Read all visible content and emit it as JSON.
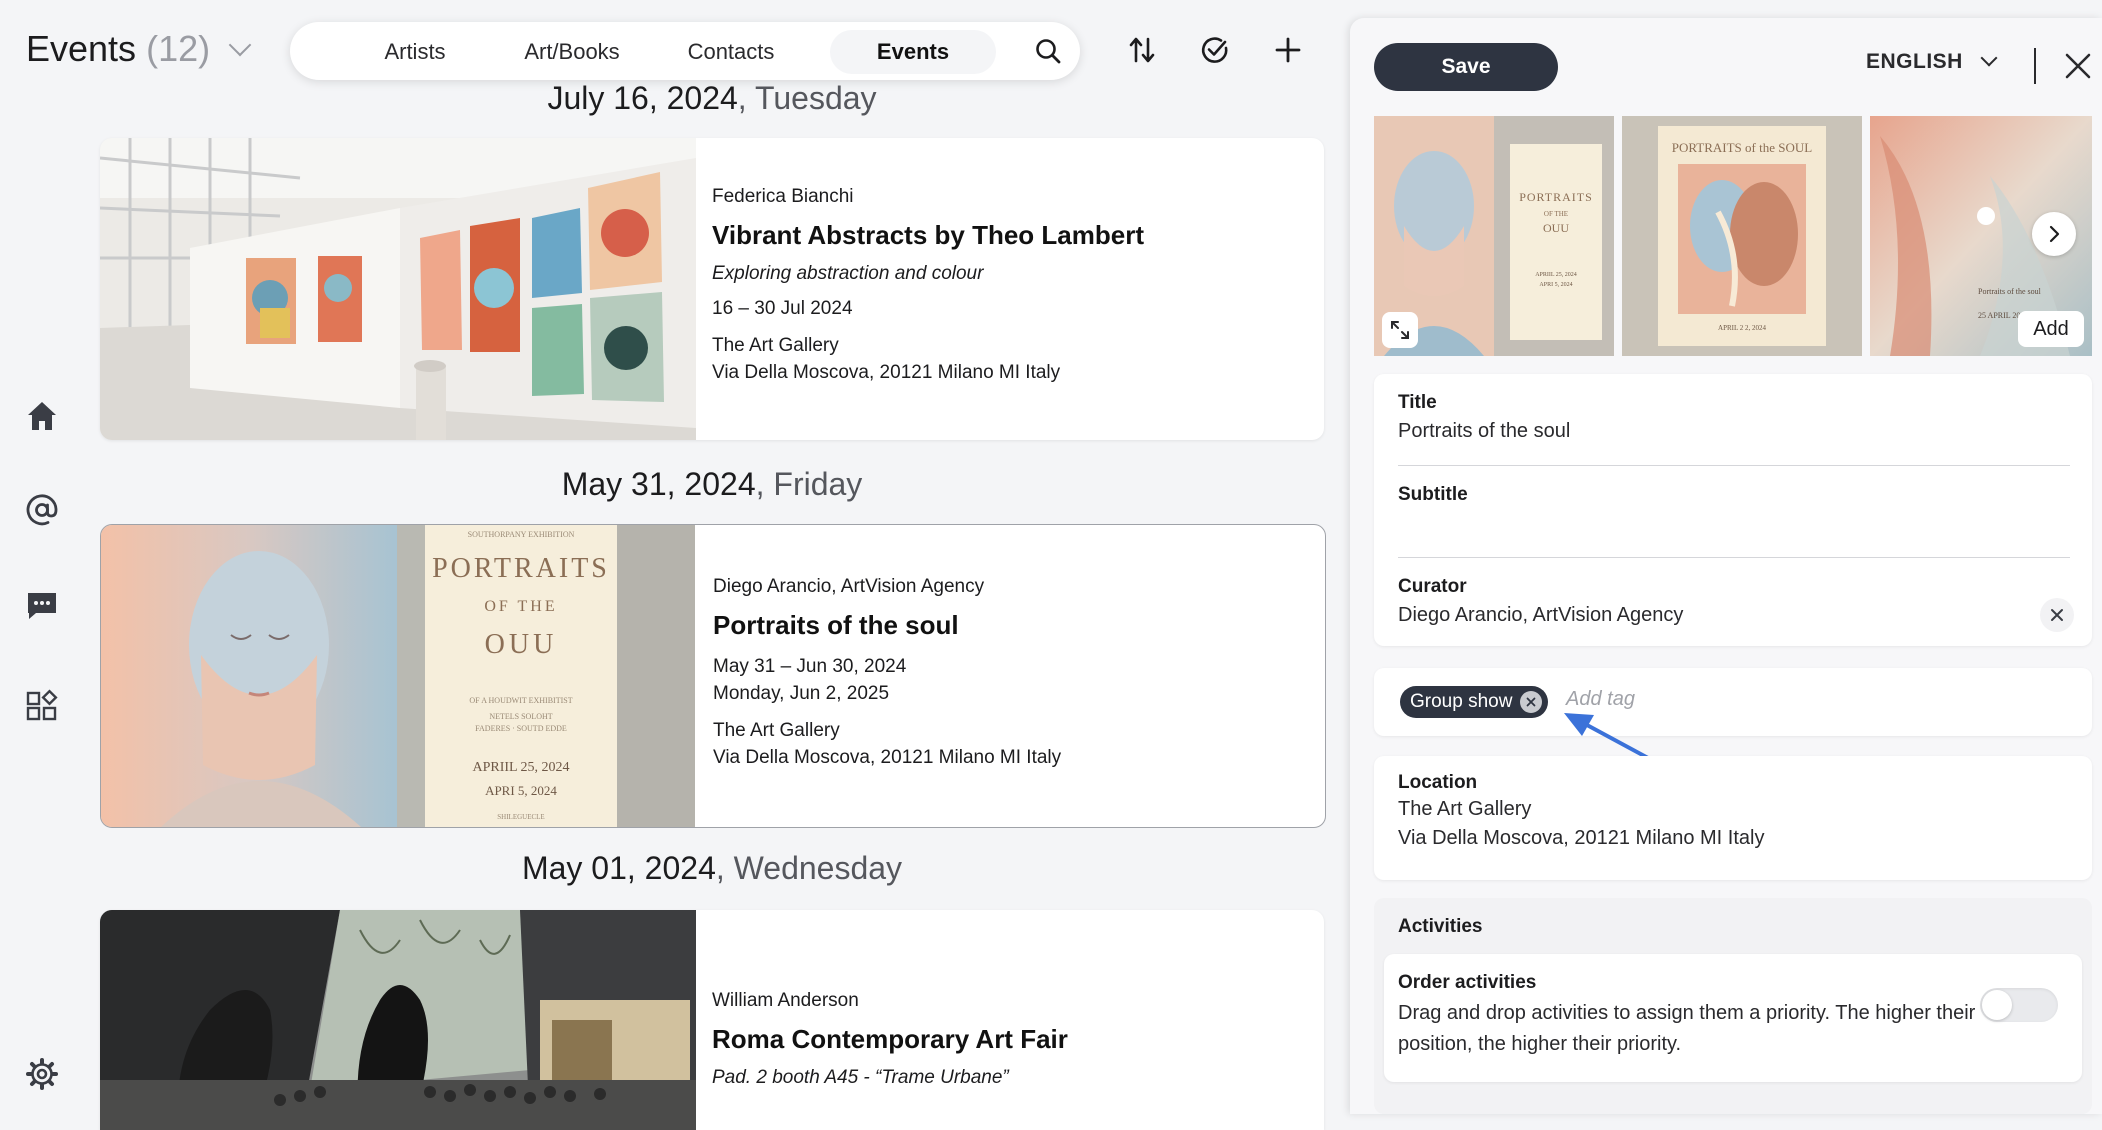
{
  "header": {
    "title": "Events",
    "count": "(12)",
    "tabs": [
      {
        "label": "Artists",
        "active": false
      },
      {
        "label": "Art/Books",
        "active": false
      },
      {
        "label": "Contacts",
        "active": false
      },
      {
        "label": "Events",
        "active": true
      }
    ],
    "icons": [
      "search-icon",
      "sort-icon",
      "check-circle-icon",
      "plus-icon"
    ]
  },
  "sidebar": {
    "icons": [
      "home-icon",
      "at-icon",
      "chat-icon",
      "apps-icon",
      "settings-icon"
    ]
  },
  "events": [
    {
      "date": "July 16, 2024",
      "weekday": ", Tuesday",
      "organizer": "Federica Bianchi",
      "title": "Vibrant Abstracts by Theo Lambert",
      "subtitle": "Exploring abstraction and colour",
      "dates": [
        "16 – 30 Jul 2024"
      ],
      "venue": "The Art Gallery",
      "address": "Via Della Moscova, 20121 Milano MI Italy"
    },
    {
      "date": "May 31, 2024",
      "weekday": ", Friday",
      "organizer": "Diego Arancio, ArtVision Agency",
      "title": "Portraits of the soul",
      "subtitle": "",
      "dates": [
        "May 31 – Jun 30, 2024",
        "Monday, Jun 2, 2025"
      ],
      "venue": "The Art Gallery",
      "address": "Via Della Moscova, 20121 Milano MI Italy",
      "poster": {
        "heading": "SOUTHORPANY EXHIBITION",
        "title1": "PORTRAITS",
        "title2": "OF THE",
        "title3": "OUU",
        "small1": "OF A HOUDWIT EXHIBITIST",
        "small2": "NETELS SOLOHT",
        "small3": "FADERES · SOUTD EDDE",
        "date1": "APRIIL 25, 2024",
        "date2": "APRI 5, 2024",
        "footer": "SHILEGUECLE"
      }
    },
    {
      "date": "May 01, 2024",
      "weekday": ", Wednesday",
      "organizer": "William Anderson",
      "title": "Roma Contemporary Art Fair",
      "subtitle": "Pad. 2 booth A45 - “Trame Urbane”"
    }
  ],
  "panel": {
    "save_label": "Save",
    "language": "ENGLISH",
    "gallery_add_label": "Add",
    "gallery_poster_title": "PORTRAITS of the SOUL",
    "gallery_poster_date": "APRIL 2 2, 2024",
    "gallery_third_title": "Portraits of the soul",
    "gallery_third_date": "25 APRIL 2024",
    "title_label": "Title",
    "title_value": "Portraits of the soul",
    "subtitle_label": "Subtitle",
    "subtitle_value": "",
    "curator_label": "Curator",
    "curator_value": "Diego Arancio, ArtVision Agency",
    "tag": "Group show",
    "tag_placeholder": "Add tag",
    "location_label": "Location",
    "location_line1": "The Art Gallery",
    "location_line2": "Via Della Moscova, 20121 Milano MI Italy",
    "activities_label": "Activities",
    "order_label": "Order activities",
    "order_desc": "Drag and drop activities to assign them a priority. The higher their position, the higher their priority.",
    "order_toggle_on": false
  },
  "colors": {
    "accent_dark": "#2e3441",
    "annotation_arrow": "#3b72d9"
  }
}
